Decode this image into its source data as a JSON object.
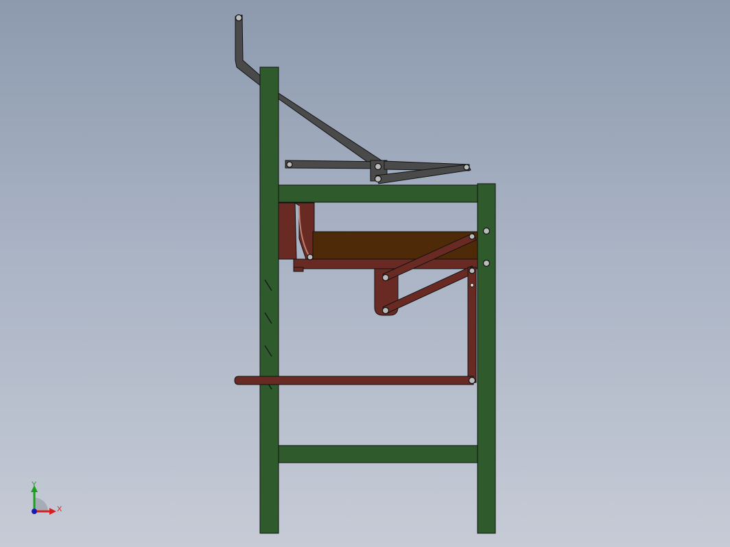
{
  "viewport": {
    "background_top": "#8d9aae",
    "background_bottom": "#c6cbd6"
  },
  "colors": {
    "frame_green": "#2f5a2c",
    "linkage_dark": "#4a4a4a",
    "mechanism_red": "#6a2a24",
    "tray_brown": "#4f2a08",
    "edge": "#111111"
  },
  "triad": {
    "x_label": "X",
    "y_label": "Y",
    "x_color": "#d42020",
    "y_color": "#1aa01a",
    "z_color": "#1a1ab0"
  }
}
